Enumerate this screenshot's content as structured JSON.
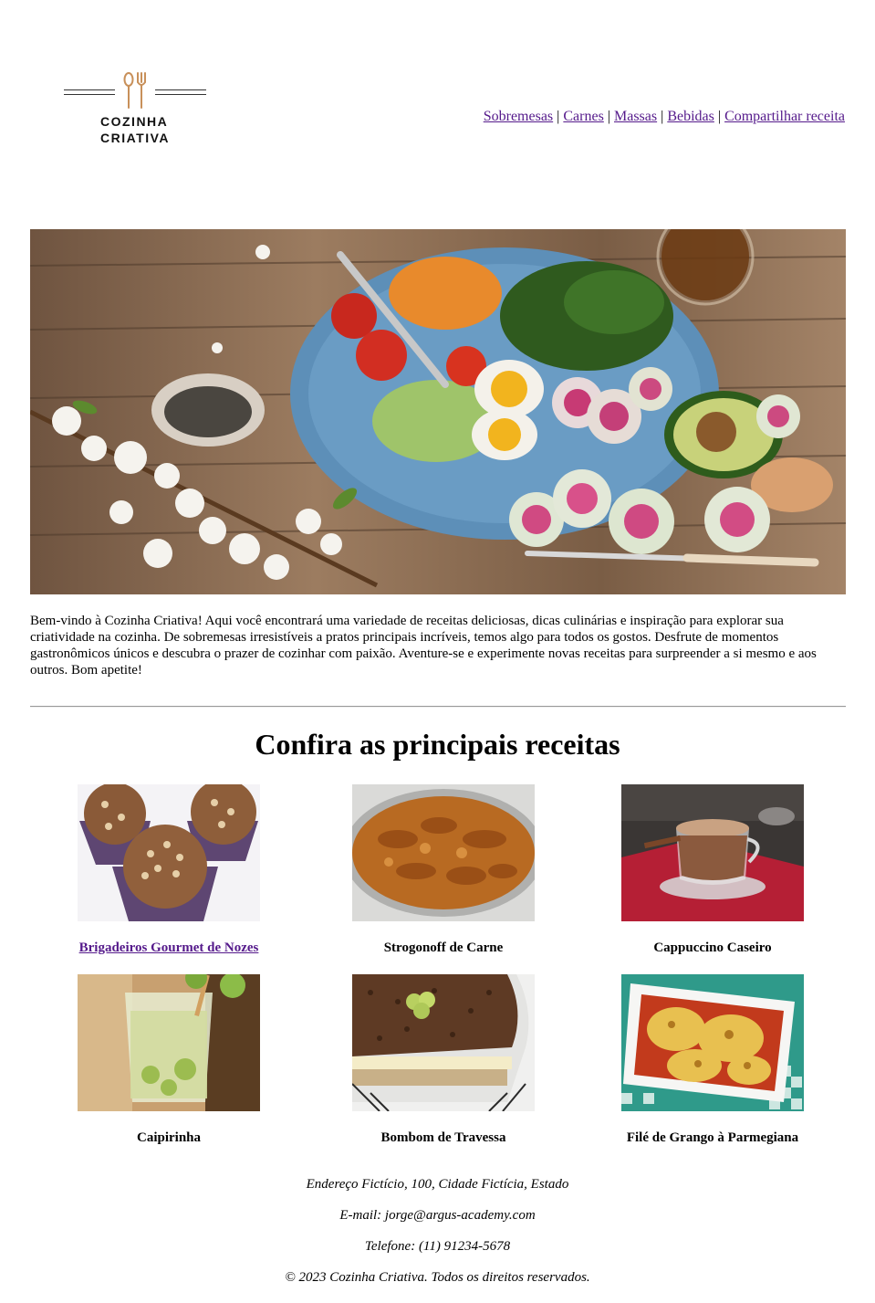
{
  "brand": {
    "name_line1": "COZINHA",
    "name_line2": "CRIATIVA"
  },
  "nav": {
    "items": [
      {
        "label": "Sobremesas"
      },
      {
        "label": "Carnes"
      },
      {
        "label": "Massas"
      },
      {
        "label": "Bebidas"
      },
      {
        "label": "Compartilhar receita"
      }
    ],
    "separator": "|"
  },
  "intro": {
    "text": "Bem-vindo à Cozinha Criativa! Aqui você encontrará uma variedade de receitas deliciosas, dicas culinárias e inspiração para explorar sua criatividade na cozinha. De sobremesas irresistíveis a pratos principais incríveis, temos algo para todos os gostos. Desfrute de momentos gastronômicos únicos e descubra o prazer de cozinhar com paixão. Aventure-se e experimente novas receitas para surpreender a si mesmo e aos outros. Bom apetite!"
  },
  "section": {
    "title": "Confira as principais receitas"
  },
  "recipes": [
    {
      "name": "Brigadeiros Gourmet de Nozes",
      "is_link": true
    },
    {
      "name": "Strogonoff de Carne",
      "is_link": false
    },
    {
      "name": "Cappuccino Caseiro",
      "is_link": false
    },
    {
      "name": "Caipirinha",
      "is_link": false
    },
    {
      "name": "Bombom de Travessa",
      "is_link": false
    },
    {
      "name": "Filé de Grango à Parmegiana",
      "is_link": false
    }
  ],
  "footer": {
    "address": "Endereço Fictício, 100, Cidade Fictícia, Estado",
    "email": "E-mail: jorge@argus-academy.com",
    "phone": "Telefone: (11) 91234-5678",
    "copyright": "© 2023 Cozinha Criativa. Todos os direitos reservados."
  },
  "colors": {
    "link": "#551a8b",
    "logo_accent": "#c8905a",
    "divider": "#999999"
  }
}
